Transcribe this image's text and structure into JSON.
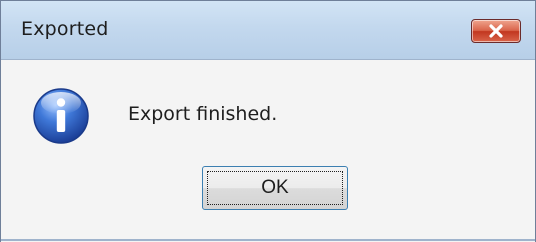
{
  "dialog": {
    "title": "Exported",
    "message": "Export finished.",
    "ok_label": "OK",
    "close_icon": "close-icon",
    "message_icon": "info-icon"
  },
  "colors": {
    "titlebar": "#c3d8ee",
    "close_button": "#d9644a",
    "info_icon": "#2f63c6",
    "focus_border": "#3c7fb1"
  }
}
